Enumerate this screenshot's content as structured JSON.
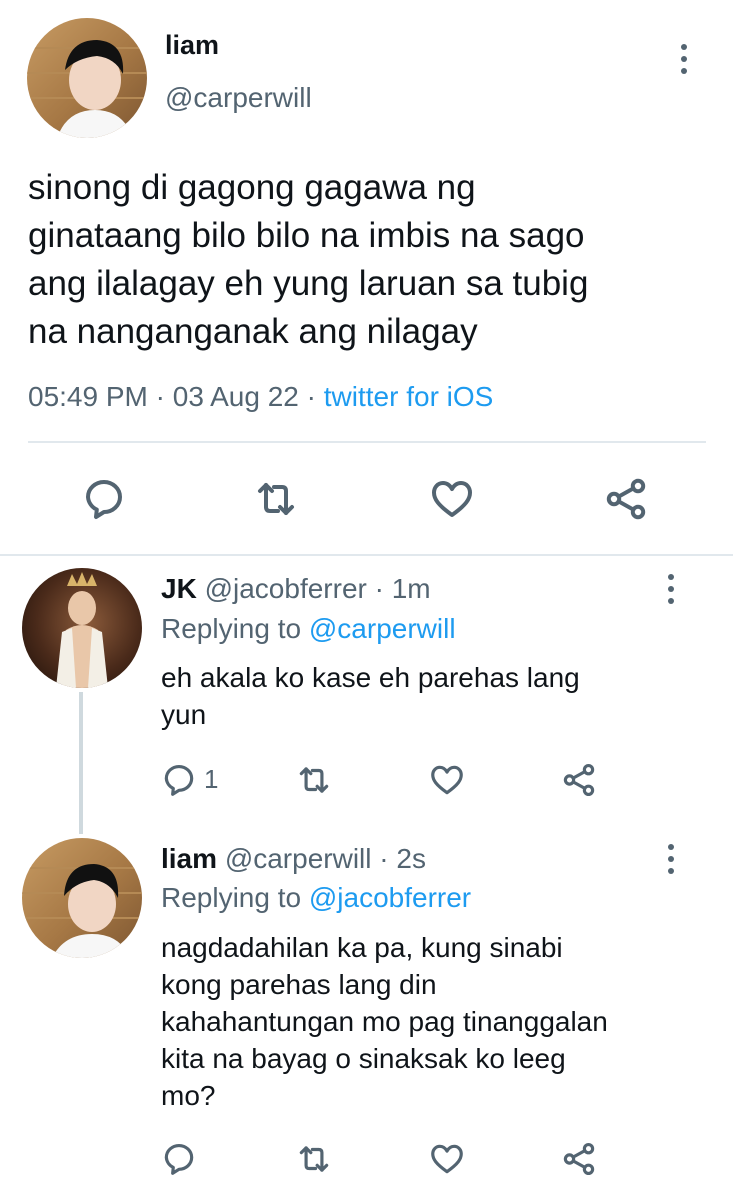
{
  "main_tweet": {
    "display_name": "liam",
    "handle": "@carperwill",
    "text_lines": [
      "sinong di gagong gagawa ng",
      "ginataang bilo bilo na imbis na sago",
      "ang ilalagay eh yung laruan sa tubig",
      "na nanganganak ang nilagay"
    ],
    "time": "05:49 PM",
    "date": "03 Aug 22",
    "separator": "·",
    "source": "twitter for iOS"
  },
  "replies": [
    {
      "display_name": "JK",
      "handle": "@jacobferrer",
      "age": "1m",
      "replying_label": "Replying to",
      "replying_to": "@carperwill",
      "text_lines": [
        "eh akala ko kase eh parehas lang",
        "yun"
      ],
      "reply_count": "1"
    },
    {
      "display_name": "liam",
      "handle": "@carperwill",
      "age": "2s",
      "replying_label": "Replying to",
      "replying_to": "@jacobferrer",
      "text_lines": [
        "nagdadahilan ka pa, kung sinabi",
        "kong parehas lang din",
        "kahahantungan mo pag tinanggalan",
        "kita na bayag o sinaksak ko leeg",
        "mo?"
      ],
      "reply_count": ""
    }
  ],
  "colors": {
    "text": "#0f1419",
    "muted": "#536471",
    "link": "#1d9bf0",
    "divider": "#e1e8ed"
  },
  "icons": [
    "more-vertical-icon",
    "reply-icon",
    "retweet-icon",
    "like-icon",
    "share-icon"
  ]
}
